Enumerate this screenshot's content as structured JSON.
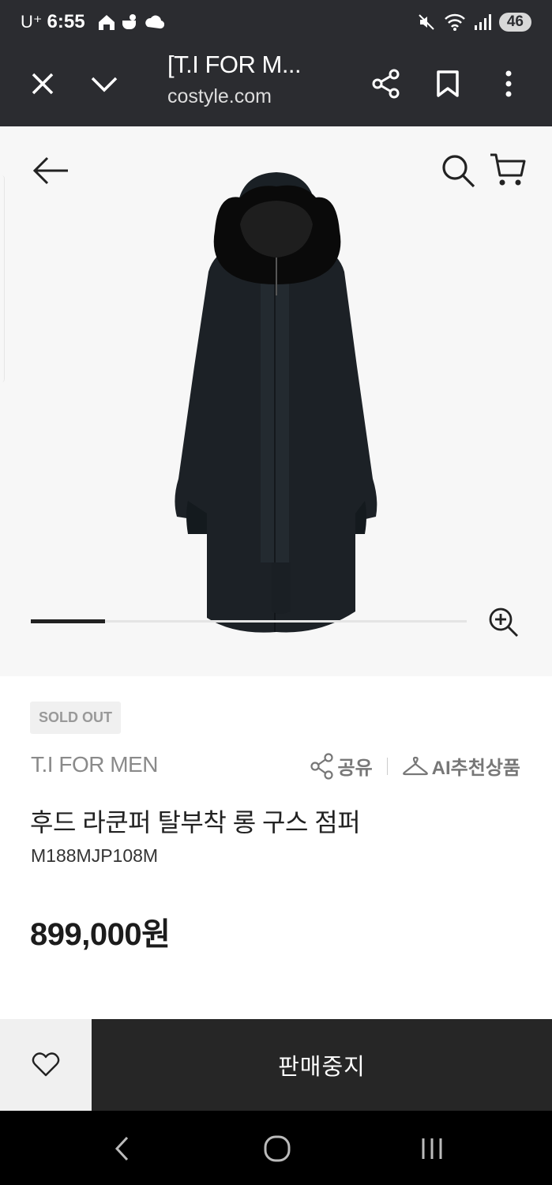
{
  "status": {
    "carrier": "U⁺",
    "time": "6:55",
    "battery": "46"
  },
  "browser": {
    "title": "[T.I FOR M...",
    "url": "costyle.com"
  },
  "product": {
    "badge": "SOLD OUT",
    "brand": "T.I FOR MEN",
    "share_label": "공유",
    "ai_label": "AI추천상품",
    "name": "후드 라쿤퍼 탈부착 롱 구스 점퍼",
    "code": "M188MJP108M",
    "price": "899,000원",
    "gallery_progress": 0.17
  },
  "actions": {
    "stop_label": "판매중지"
  },
  "colors": {
    "chrome": "#2b2c30",
    "dark_button": "#262626",
    "hero_bg": "#f7f7f7"
  }
}
